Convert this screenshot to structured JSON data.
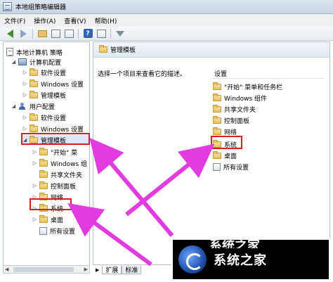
{
  "window": {
    "title": "本地组策略编辑器"
  },
  "menu": [
    "文件(F)",
    "操作(A)",
    "查看(V)",
    "帮助(H)"
  ],
  "toolbar": {
    "icons": [
      "back-arrow-icon",
      "forward-arrow-icon",
      "folder-up-icon",
      "show-hide-tree-icon",
      "export-list-icon",
      "help-icon",
      "properties-icon",
      "filter-icon"
    ]
  },
  "tree": {
    "root": "本地计算机 策略",
    "computer_config": "计算机配置",
    "cc_software": "软件设置",
    "cc_windows": "Windows 设置",
    "cc_admin_templates": "管理模板",
    "user_config": "用户配置",
    "uc_software": "软件设置",
    "uc_windows": "Windows 设置",
    "uc_admin_templates": "管理模板",
    "start_menu": "\"开始\" 菜",
    "windows_components": "Windows 组",
    "shared_folders": "共享文件夹",
    "control_panel": "控制面板",
    "network": "网络",
    "system": "系统",
    "desktop": "桌面",
    "all_settings": "所有设置"
  },
  "right": {
    "header": "管理模板",
    "description": "选择一个项目来查看它的描述。",
    "column_header": "设置",
    "items": [
      "\"开始\" 菜单和任务栏",
      "Windows 组件",
      "共享文件夹",
      "控制面板",
      "网络",
      "系统",
      "桌面",
      "所有设置"
    ]
  },
  "tabs": {
    "extended": "扩展",
    "standard": "标准"
  },
  "watermark": {
    "text": "系统之家",
    "ghost": "系统之家"
  },
  "colors": {
    "highlight": "#d81f26",
    "arrow": "#e23ce0"
  }
}
